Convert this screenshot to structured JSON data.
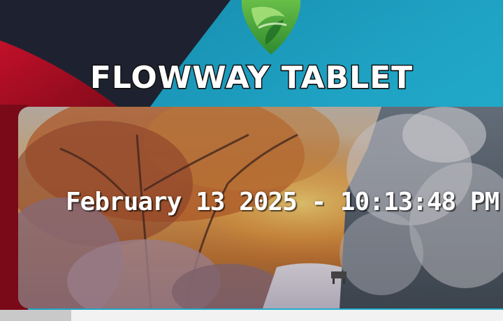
{
  "brand": {
    "title": "FLOWWAY TABLET",
    "logo_icon": "leaf-shield-logo-icon"
  },
  "clock": {
    "datetime": "February 13 2025 - 10:13:48 PM"
  },
  "background": {
    "photo": "winter-forest-sunset-photo"
  },
  "bottom_bar": {
    "tab_icon": "bottom-tab"
  },
  "colors": {
    "teal": "#1fa3c4",
    "dark": "#1e2230",
    "red": "#a30d22",
    "logo_green": "#4cae3a"
  }
}
